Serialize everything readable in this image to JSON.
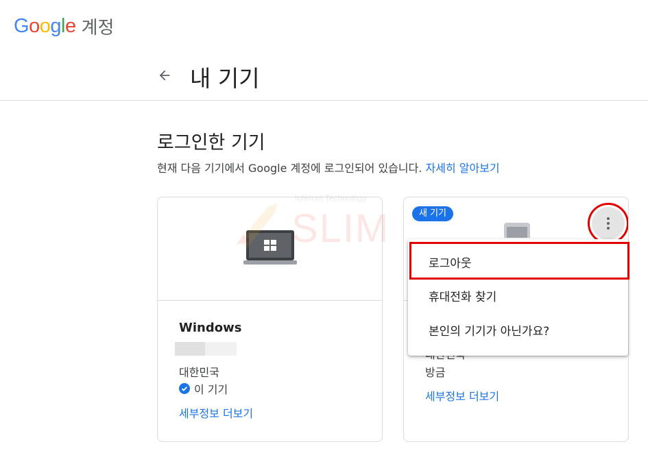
{
  "brand": {
    "logo_letters": [
      {
        "ch": "G",
        "color": "#4285F4"
      },
      {
        "ch": "o",
        "color": "#EA4335"
      },
      {
        "ch": "o",
        "color": "#FBBC05"
      },
      {
        "ch": "g",
        "color": "#4285F4"
      },
      {
        "ch": "l",
        "color": "#34A853"
      },
      {
        "ch": "e",
        "color": "#EA4335"
      }
    ],
    "suffix": "계정"
  },
  "header": {
    "back_icon": "arrow-back-icon",
    "title": "내 기기"
  },
  "section": {
    "title": "로그인한 기기",
    "description": "현재 다음 기기에서 Google 계정에 로그인되어 있습니다.",
    "learn_more": "자세히 알아보기"
  },
  "watermark": {
    "tagline": "Internet Technology",
    "name": "SLIM"
  },
  "devices": [
    {
      "icon": "laptop-windows-icon",
      "name": "Windows",
      "country": "대한민국",
      "status": "이 기기",
      "details_link": "세부정보 더보기"
    },
    {
      "badge": "새 기기",
      "icon": "phone-icon",
      "country": "대한민국",
      "carrier": "방금",
      "details_link": "세부정보 더보기",
      "more_icon": "more-vert-icon"
    }
  ],
  "menu": {
    "items": [
      "로그아웃",
      "휴대전화 찾기",
      "본인의 기기가 아닌가요?"
    ]
  },
  "colors": {
    "accent": "#1a73e8",
    "highlight": "#e00000",
    "border": "#dadce0"
  }
}
